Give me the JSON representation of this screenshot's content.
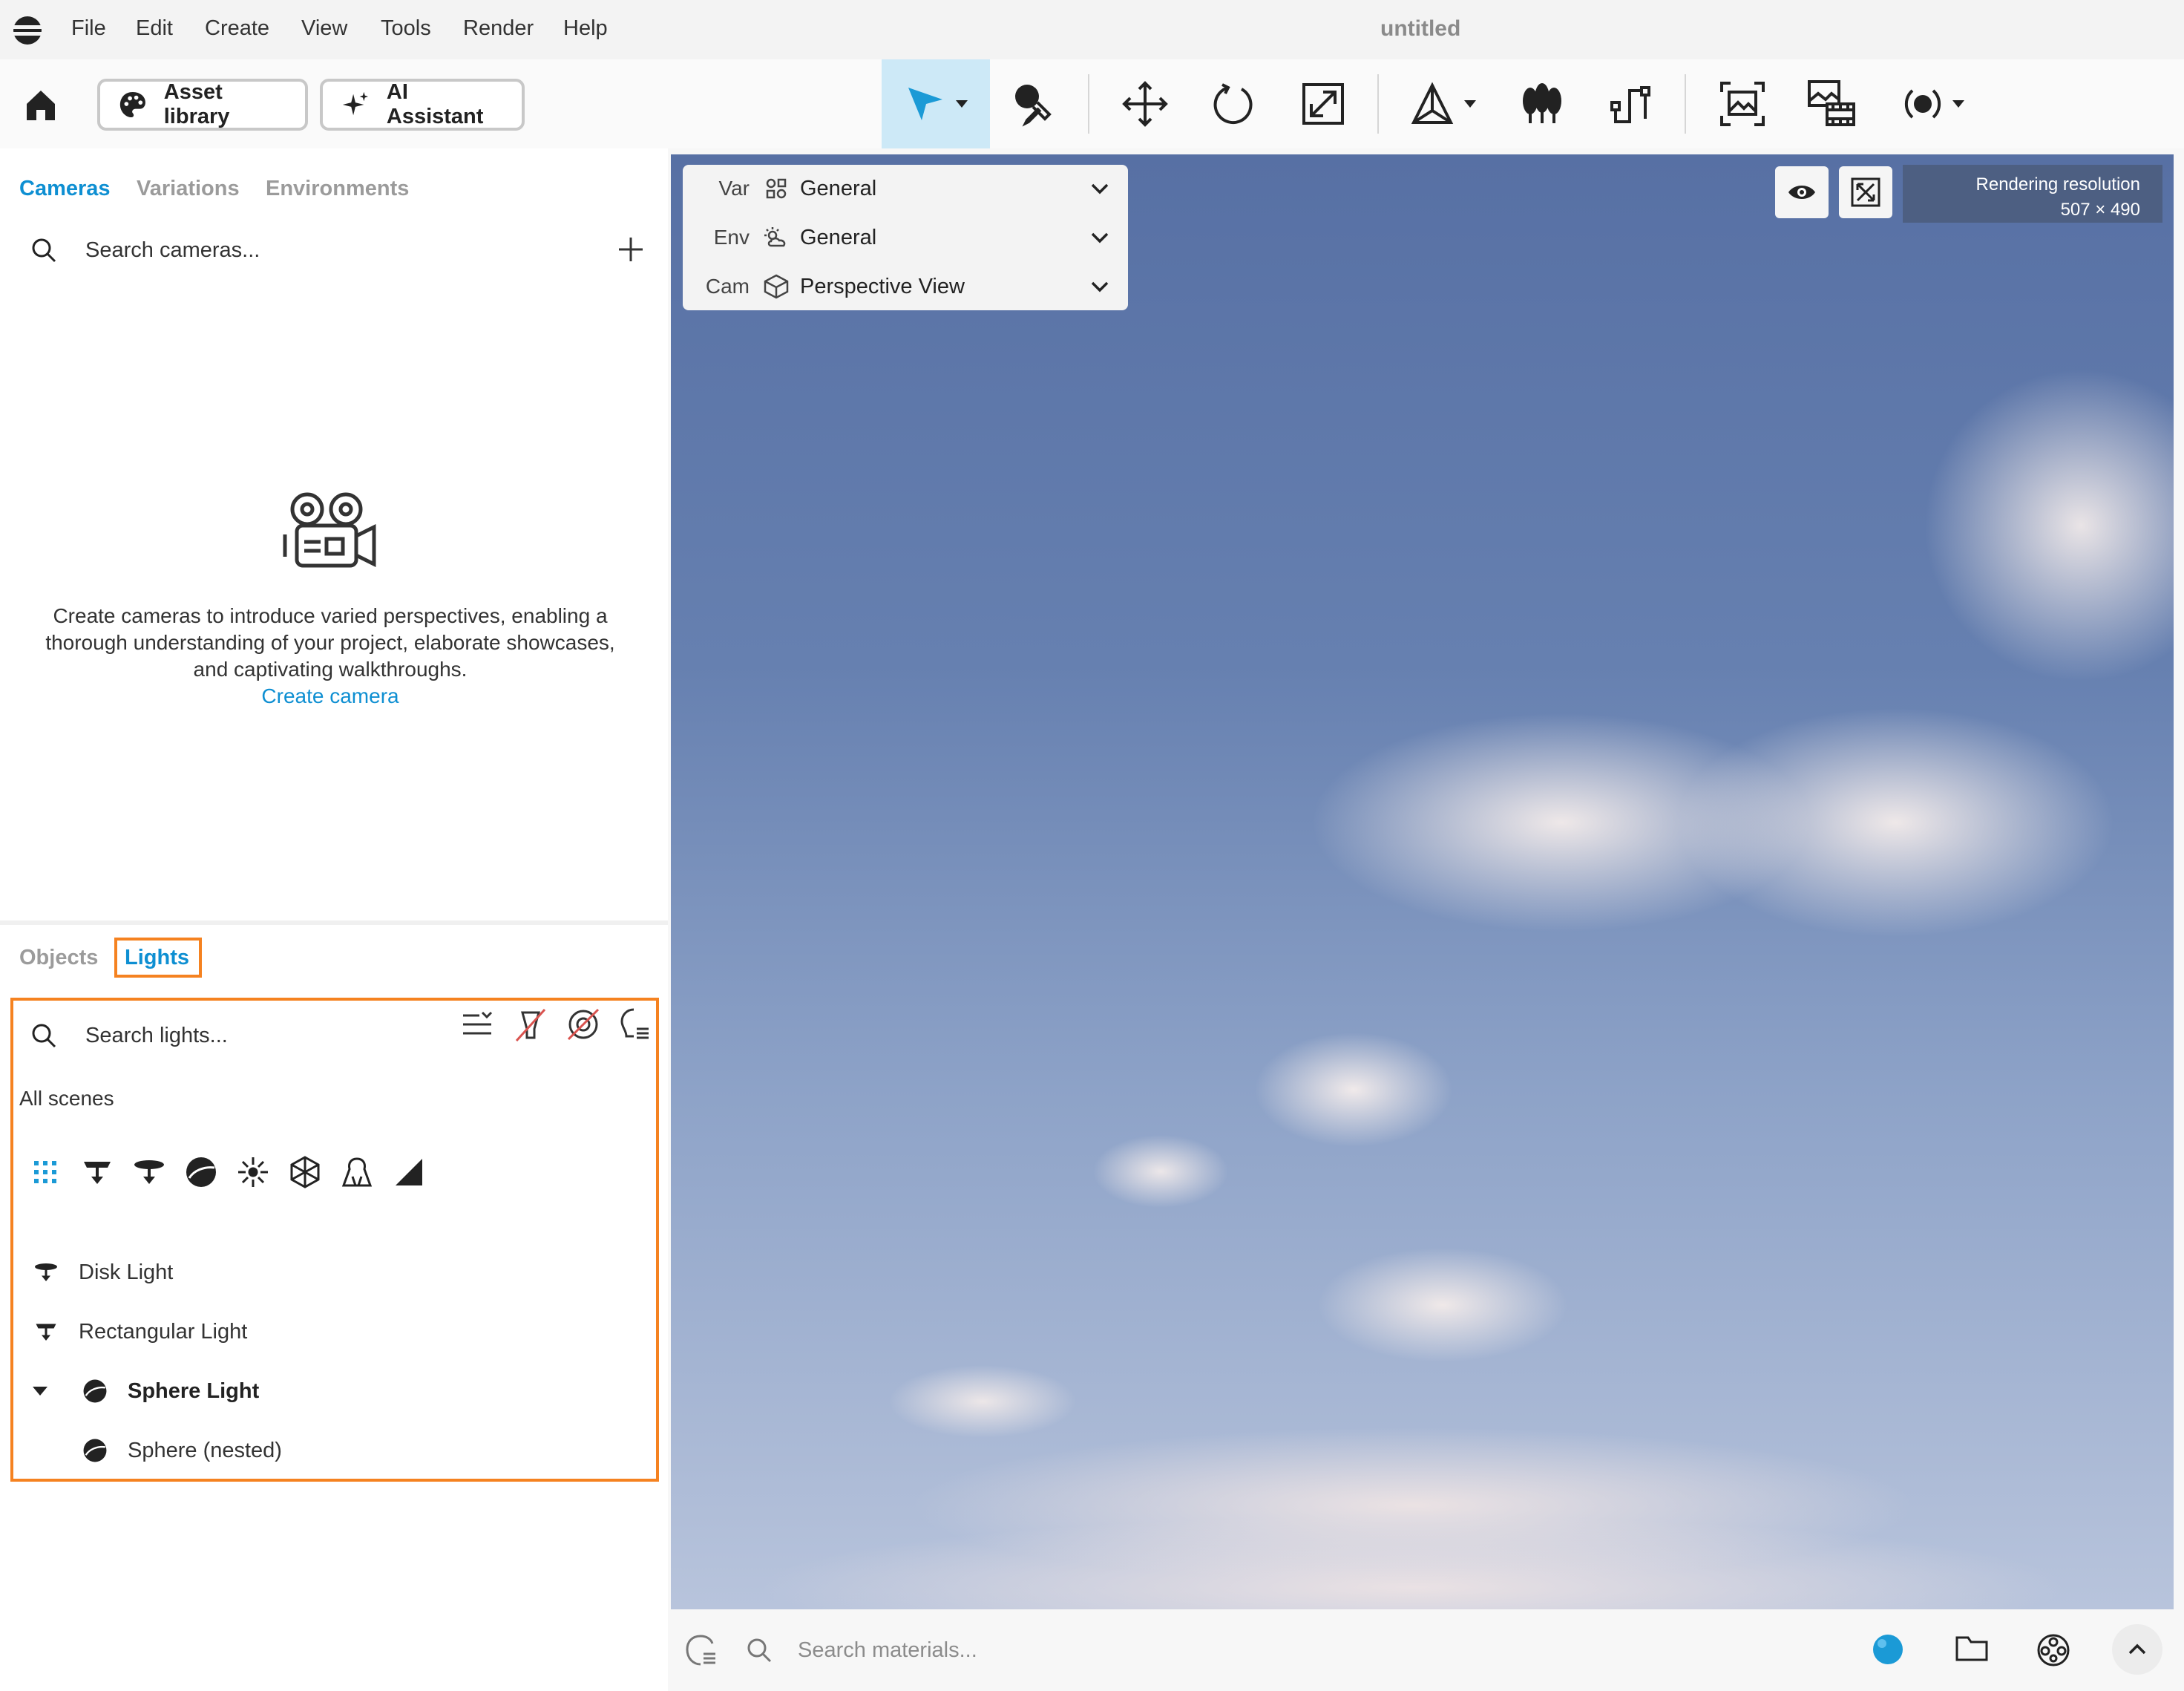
{
  "menubar": {
    "items": [
      "File",
      "Edit",
      "Create",
      "View",
      "Tools",
      "Render",
      "Help"
    ],
    "title": "untitled"
  },
  "toolbar": {
    "asset_library_label": "Asset library",
    "ai_assistant_label": "AI Assistant",
    "tools": [
      "select-arrow-icon",
      "eyedropper-icon",
      "move-icon",
      "rotate-icon",
      "scale-icon",
      "pivot-icon",
      "scatter-icon",
      "path-icon",
      "render-image-icon",
      "render-animation-icon",
      "record-icon"
    ]
  },
  "cameras_panel": {
    "tabs": [
      "Cameras",
      "Variations",
      "Environments"
    ],
    "active_tab": "Cameras",
    "search_placeholder": "Search cameras...",
    "empty_text": "Create cameras to introduce varied perspectives, enabling a thorough understanding of your project, elaborate showcases, and captivating walkthroughs.",
    "create_link": "Create camera"
  },
  "lights_panel": {
    "tabs": [
      "Objects",
      "Lights"
    ],
    "active_tab": "Lights",
    "search_placeholder": "Search lights...",
    "scope_label": "All scenes",
    "filters": [
      "grid-filter-icon",
      "rectangular-light-icon",
      "disk-light-icon",
      "sphere-light-icon",
      "point-light-icon",
      "ies-light-icon",
      "spot-light-icon",
      "directional-light-icon"
    ],
    "items": [
      {
        "label": "Disk Light",
        "icon": "disk-light-icon",
        "bold": false,
        "indent": 0
      },
      {
        "label": "Rectangular Light",
        "icon": "rectangular-light-icon",
        "bold": false,
        "indent": 0
      },
      {
        "label": "Sphere Light",
        "icon": "sphere-light-icon",
        "bold": true,
        "indent": 0,
        "expanded": true
      },
      {
        "label": "Sphere (nested)",
        "icon": "sphere-light-icon",
        "bold": false,
        "indent": 1
      }
    ]
  },
  "viewport": {
    "selectors": [
      {
        "key": "Var",
        "value": "General"
      },
      {
        "key": "Env",
        "value": "General"
      },
      {
        "key": "Cam",
        "value": "Perspective View"
      }
    ],
    "render_resolution_label": "Rendering resolution",
    "render_resolution_value": "507 × 490"
  },
  "materials_bar": {
    "search_placeholder": "Search materials..."
  },
  "colors": {
    "accent": "#0e8fd2",
    "highlight_box": "#f58220",
    "active_tool_bg": "#cde9f7"
  }
}
